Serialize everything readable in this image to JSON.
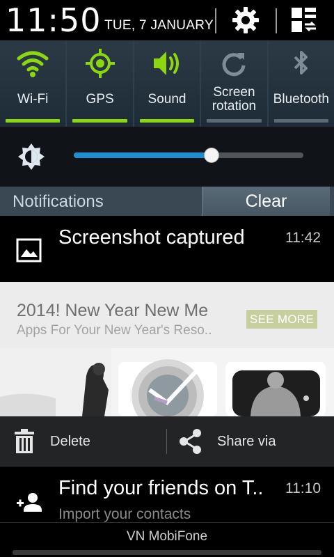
{
  "status": {
    "time": "11:50",
    "date": "TUE, 7 JANUARY"
  },
  "quick_settings": [
    {
      "label": "Wi-Fi",
      "icon": "wifi-icon",
      "active": true
    },
    {
      "label": "GPS",
      "icon": "gps-icon",
      "active": true
    },
    {
      "label": "Sound",
      "icon": "sound-icon",
      "active": true
    },
    {
      "label": "Screen rotation",
      "icon": "rotation-icon",
      "active": false
    },
    {
      "label": "Bluetooth",
      "icon": "bluetooth-icon",
      "active": false
    }
  ],
  "brightness": {
    "level": 0.6
  },
  "notifications_header": {
    "title": "Notifications",
    "clear_label": "Clear"
  },
  "notifications": {
    "screenshot": {
      "title": "Screenshot captured",
      "time": "11:42"
    },
    "ad": {
      "title": "2014! New Year New Me",
      "subtitle": "Apps For Your New Year's Reso..",
      "button": "SEE MORE"
    },
    "actions": {
      "delete_label": "Delete",
      "share_label": "Share via"
    },
    "friends": {
      "title": "Find your friends on T..",
      "subtitle": "Import your contacts",
      "time": "11:10"
    }
  },
  "footer": {
    "carrier": "VN MobiFone"
  },
  "colors": {
    "active": "#8dd612",
    "inactive": "#7d8c97",
    "slider": "#1b8fd0"
  }
}
